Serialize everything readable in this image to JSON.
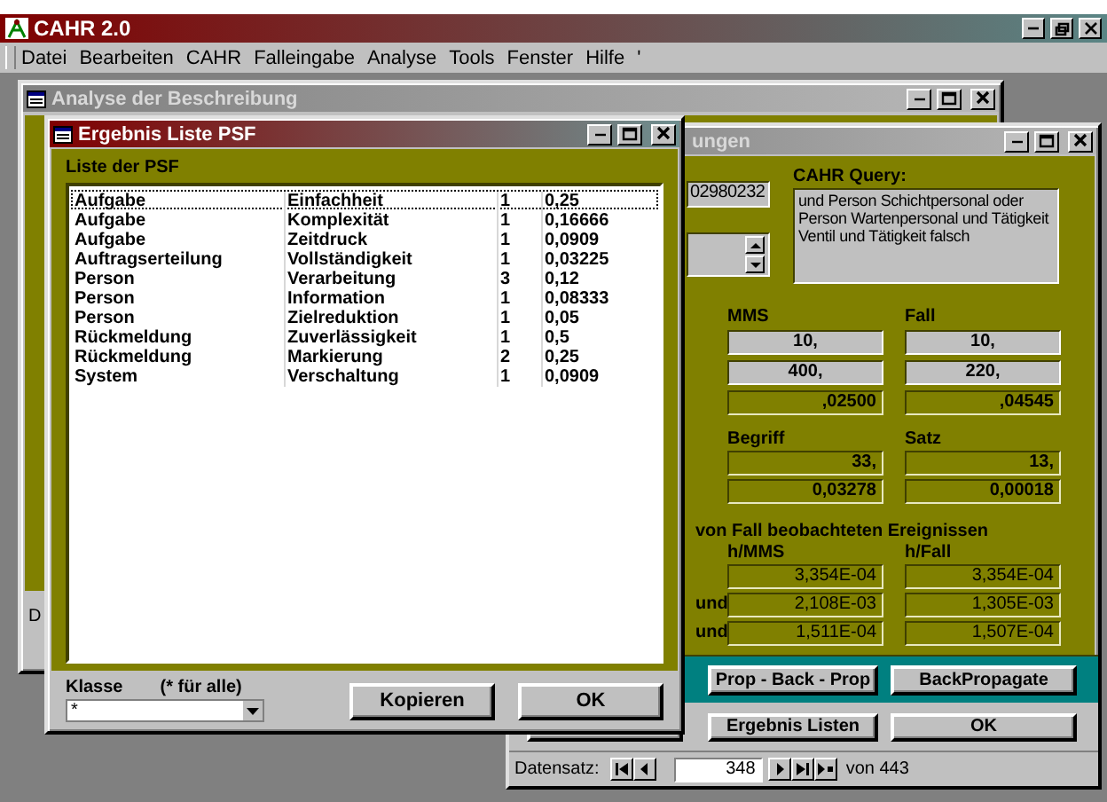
{
  "app": {
    "title": "CAHR 2.0"
  },
  "menu": [
    {
      "label": "Datei"
    },
    {
      "label": "Bearbeiten"
    },
    {
      "label": "CAHR"
    },
    {
      "label": "Falleingabe"
    },
    {
      "label": "Analyse"
    },
    {
      "label": "Tools"
    },
    {
      "label": "Fenster"
    },
    {
      "label": "Hilfe"
    },
    {
      "label": "'"
    }
  ],
  "analysis_window": {
    "title": "Analyse der Beschreibung",
    "active": false,
    "nav_fragment": "D"
  },
  "query_window": {
    "title": "ungen",
    "active": false,
    "id_value": "02980232",
    "query_label": "CAHR Query:",
    "query_text": "und Person Schichtpersonal oder Person Wartenpersonal und Tätigkeit Ventil und Tätigkeit falsch",
    "counts": {
      "columns": [
        "MMS",
        "Fall"
      ],
      "rows": [
        {
          "kind": "input",
          "values": [
            "10,",
            "10,"
          ]
        },
        {
          "kind": "input",
          "values": [
            "400,",
            "220,"
          ]
        },
        {
          "kind": "display",
          "values": [
            ",02500",
            ",04545"
          ]
        }
      ]
    },
    "terms": {
      "columns": [
        "Begriff",
        "Satz"
      ],
      "rows": [
        {
          "kind": "display",
          "values": [
            "33,",
            "13,"
          ]
        },
        {
          "kind": "display",
          "values": [
            "0,03278",
            "0,00018"
          ]
        }
      ]
    },
    "events_heading": "von Fall beobachteten Ereignissen",
    "events": {
      "columns": [
        "h/MMS",
        "h/Fall"
      ],
      "rows": [
        {
          "values": [
            "3,354E-04",
            "3,354E-04"
          ]
        },
        {
          "prefix": "und",
          "values": [
            "2,108E-03",
            "1,305E-03"
          ]
        },
        {
          "prefix": "und",
          "values": [
            "1,511E-04",
            "1,507E-04"
          ]
        }
      ]
    },
    "action_buttons": [
      "Prop - Back - Prop",
      "BackPropagate"
    ],
    "lower_buttons": [
      "Ergebnis Listen",
      "OK"
    ],
    "navigation": {
      "label": "Datensatz:",
      "current": "348",
      "total": "von 443"
    }
  },
  "psf_window": {
    "title": "Ergebnis Liste PSF",
    "active": true,
    "list_label": "Liste der PSF",
    "rows": [
      {
        "cells": [
          "Aufgabe",
          "Einfachheit",
          "1",
          "0,25"
        ],
        "selected": true
      },
      {
        "cells": [
          "Aufgabe",
          "Komplexität",
          "1",
          "0,16666"
        ],
        "selected": false
      },
      {
        "cells": [
          "Aufgabe",
          "Zeitdruck",
          "1",
          "0,0909"
        ],
        "selected": false
      },
      {
        "cells": [
          "Auftragserteilung",
          "Vollständigkeit",
          "1",
          "0,03225"
        ],
        "selected": false
      },
      {
        "cells": [
          "Person",
          "Verarbeitung",
          "3",
          "0,12"
        ],
        "selected": false
      },
      {
        "cells": [
          "Person",
          "Information",
          "1",
          "0,08333"
        ],
        "selected": false
      },
      {
        "cells": [
          "Person",
          "Zielreduktion",
          "1",
          "0,05"
        ],
        "selected": false
      },
      {
        "cells": [
          "Rückmeldung",
          "Zuverlässigkeit",
          "1",
          "0,5"
        ],
        "selected": false
      },
      {
        "cells": [
          "Rückmeldung",
          "Markierung",
          "2",
          "0,25"
        ],
        "selected": false
      },
      {
        "cells": [
          "System",
          "Verschaltung",
          "1",
          "0,0909"
        ],
        "selected": false
      }
    ],
    "class_label": "Klasse",
    "class_hint": "(* für alle)",
    "class_value": "*",
    "buttons": [
      "Kopieren",
      "OK"
    ]
  }
}
